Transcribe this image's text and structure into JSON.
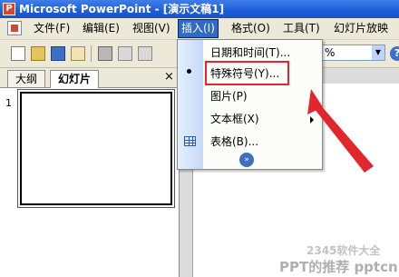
{
  "window": {
    "title": "Microsoft PowerPoint - [演示文稿1]"
  },
  "menubar": {
    "items": [
      "文件(F)",
      "编辑(E)",
      "视图(V)",
      "插入(I)",
      "格式(O)",
      "工具(T)",
      "幻灯片放映"
    ],
    "active": "插入(I)"
  },
  "toolbar": {
    "icons": [
      "new-icon",
      "open-icon",
      "save-icon",
      "permission-icon",
      "print-icon",
      "print-preview-icon",
      "more-icon"
    ],
    "zoom": "%",
    "help": "?"
  },
  "pane": {
    "tabs": [
      "大纲",
      "幻灯片"
    ],
    "active_tab": "幻灯片",
    "close": "×",
    "slide_number": "1"
  },
  "insert_menu": {
    "items": [
      {
        "label": "日期和时间(T)...",
        "submenu": false
      },
      {
        "label": "特殊符号(Y)...",
        "submenu": false,
        "highlighted": true
      },
      {
        "label": "图片(P)",
        "submenu": true
      },
      {
        "label": "文本框(X)",
        "submenu": true
      },
      {
        "label": "表格(B)...",
        "submenu": false
      }
    ],
    "expand": "»"
  },
  "annotation": {
    "highlight_color": "#e2262d"
  },
  "watermark": {
    "line1": "2345软件大全",
    "line2": "PPT的推荐 pptcn"
  },
  "colors": {
    "title_bar": "#1d5dd8",
    "menu_active": "#3169c6",
    "chrome": "#ece9d8"
  }
}
